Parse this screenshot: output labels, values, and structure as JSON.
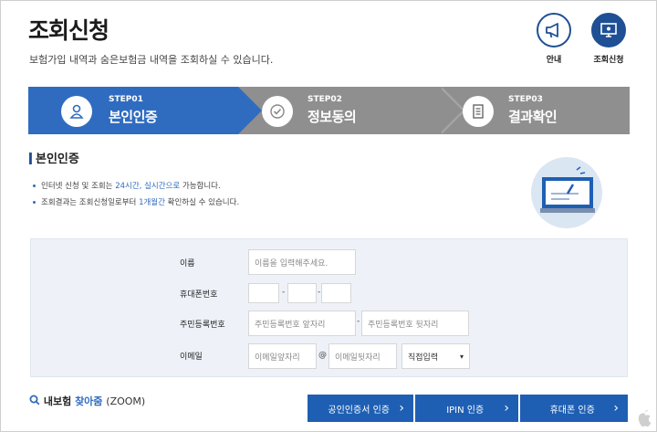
{
  "header": {
    "title": "조회신청",
    "subtitle": "보험가입 내역과 숨은보험금 내역을 조회하실 수 있습니다."
  },
  "top_icons": [
    {
      "label": "안내",
      "icon": "megaphone-icon"
    },
    {
      "label": "조회신청",
      "icon": "monitor-icon",
      "active": true
    }
  ],
  "steps": [
    {
      "num": "STEP01",
      "name": "본인인증",
      "icon": "person-icon",
      "active": true
    },
    {
      "num": "STEP02",
      "name": "정보동의",
      "icon": "check-icon"
    },
    {
      "num": "STEP03",
      "name": "결과확인",
      "icon": "document-icon"
    }
  ],
  "section": {
    "title": "본인인증",
    "notes": [
      {
        "pre": "인터넷 신청 및 조회는 ",
        "hl": "24시간, 실시간으로",
        "post": " 가능합니다."
      },
      {
        "pre": "조회결과는 조회신청일로부터 ",
        "hl": "1개월간",
        "post": " 확인하실 수 있습니다."
      }
    ]
  },
  "form": {
    "name_label": "이름",
    "name_placeholder": "이름을 입력해주세요.",
    "phone_label": "휴대폰번호",
    "phone_sep": "-",
    "rrn_label": "주민등록번호",
    "rrn_front_placeholder": "주민등록번호 앞자리",
    "rrn_back_placeholder": "주민등록번호 뒷자리",
    "rrn_sep": "-",
    "email_label": "이메일",
    "email_front_placeholder": "이메일앞자리",
    "email_at": "@",
    "email_back_placeholder": "이메일뒷자리",
    "email_domain_select": "직접입력",
    "select_arrow": "▾"
  },
  "footer": {
    "zoom_a": "내보험",
    "zoom_b": "찾아줌",
    "zoom_c": "(ZOOM)",
    "buttons": [
      "공인인증서 인증",
      "IPIN 인증",
      "휴대폰 인증"
    ],
    "arrow": "›"
  },
  "colors": {
    "accent": "#2f6cc0",
    "step_inactive": "#8f8f8f",
    "button": "#1e5fb4",
    "form_bg": "#eef2f8"
  }
}
